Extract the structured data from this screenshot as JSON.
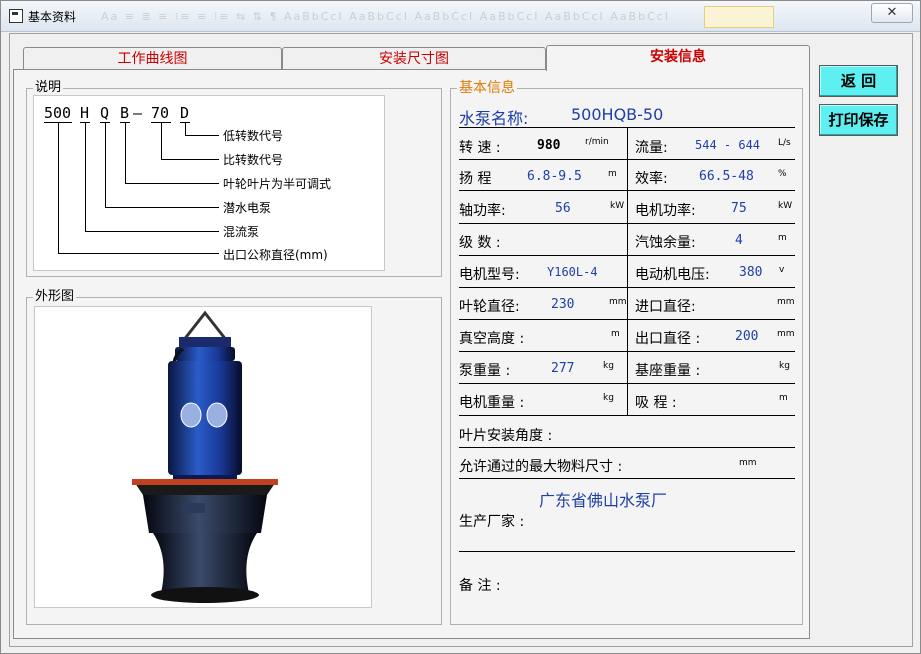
{
  "window": {
    "title": "基本资料",
    "close": "✕"
  },
  "toolbar_ghost": "Aa  ≡  ≣  ≡   ⁝≡  ≡  ⁝≡     ⇆   ⇅    ¶   AaBbCcI  AaBbCcI  AaBbCcI  AaBbCcI  AaBbCcI  AaBbCcI",
  "tabs": [
    {
      "label": "工作曲线图"
    },
    {
      "label": "安装尺寸图"
    },
    {
      "label": "安装信息"
    }
  ],
  "buttons": {
    "back": "返  回",
    "print": "打印保存"
  },
  "explain": {
    "title": "说明",
    "code": [
      "500",
      "H",
      "Q",
      "B",
      "—",
      "70",
      "D"
    ],
    "labels": [
      "低转数代号",
      "比转数代号",
      "叶轮叶片为半可调式",
      "潜水电泵",
      "混流泵",
      "出口公称直径(mm)"
    ]
  },
  "appearance": {
    "title": "外形图"
  },
  "info": {
    "title": "基本信息",
    "pump_name_label": "水泵名称:",
    "pump_name": "500HQB-50",
    "speed": {
      "label": "转  速  :",
      "value": "980",
      "unit": "r/min"
    },
    "flow": {
      "label": "流量:",
      "value": "544 - 644",
      "unit": "L/s"
    },
    "head": {
      "label": "扬  程",
      "value": "6.8-9.5",
      "unit": "m"
    },
    "efficiency": {
      "label": "效率:",
      "value": "66.5-48",
      "unit": "%"
    },
    "shaft_power": {
      "label": "轴功率:",
      "value": "56",
      "unit": "kW"
    },
    "motor_power": {
      "label": "电机功率:",
      "value": "75",
      "unit": "kW"
    },
    "stages": {
      "label": "级  数  :"
    },
    "npsh": {
      "label": "汽蚀余量:",
      "value": "4",
      "unit": "m"
    },
    "motor_model": {
      "label": "电机型号:",
      "value": "Y160L-4"
    },
    "motor_voltage": {
      "label": "电动机电压:",
      "value": "380",
      "unit": "v"
    },
    "impeller_dia": {
      "label": "叶轮直径:",
      "value": "230",
      "unit": "mm"
    },
    "inlet_dia": {
      "label": "进口直径:",
      "unit": "mm"
    },
    "vacuum": {
      "label": "真空高度  :",
      "unit": "m"
    },
    "outlet_dia": {
      "label": "出口直径  :",
      "value": "200",
      "unit": "mm"
    },
    "pump_weight": {
      "label": "泵重量  :",
      "value": "277",
      "unit": "kg"
    },
    "base_weight": {
      "label": "基座重量  :",
      "unit": "kg"
    },
    "motor_weight": {
      "label": "电机重量  :",
      "unit": "kg"
    },
    "suction": {
      "label": "吸  程  :",
      "unit": "m"
    },
    "blade_angle": {
      "label": "叶片安装角度  :"
    },
    "max_particle": {
      "label": "允许通过的最大物料尺寸  :",
      "unit": "mm"
    },
    "manufacturer_value": "广东省佛山水泵厂",
    "manufacturer_label": "生产厂家  :",
    "remark_label": "备  注  :"
  },
  "colors": {
    "tab_text": "#cc0000",
    "value_blue": "#1f3fa8",
    "button_cyan": "#5ef0f0",
    "info_title": "#e07a00"
  }
}
